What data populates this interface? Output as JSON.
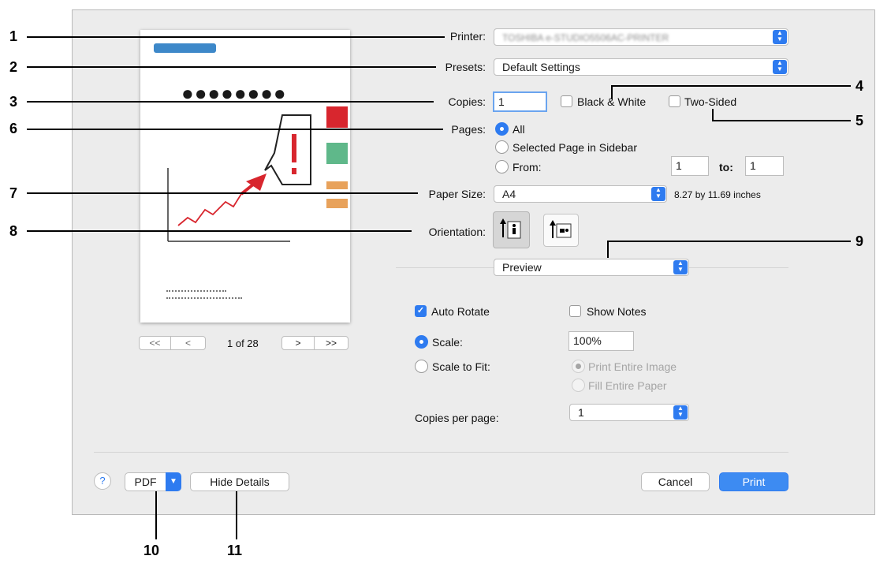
{
  "printer": {
    "label": "Printer:",
    "value": "TOSHIBA e-STUDIO5506AC-PRINTER"
  },
  "presets": {
    "label": "Presets:",
    "value": "Default Settings"
  },
  "copies": {
    "label": "Copies:",
    "value": "1",
    "bw_label": "Black & White",
    "two_sided_label": "Two-Sided"
  },
  "pages": {
    "label": "Pages:",
    "all": "All",
    "selected": "Selected Page in Sidebar",
    "from": "From:",
    "from_value": "1",
    "to_label": "to:",
    "to_value": "1"
  },
  "paper_size": {
    "label": "Paper Size:",
    "value": "A4",
    "dims": "8.27 by 11.69 inches"
  },
  "orientation": {
    "label": "Orientation:"
  },
  "section_popup": {
    "value": "Preview"
  },
  "preview_opts": {
    "auto_rotate": "Auto Rotate",
    "show_notes": "Show Notes",
    "scale": "Scale:",
    "scale_value": "100%",
    "scale_to_fit": "Scale to Fit:",
    "print_entire": "Print Entire Image",
    "fill_entire": "Fill Entire Paper",
    "copies_per_page": "Copies per page:",
    "copies_per_page_value": "1"
  },
  "nav": {
    "first": "<<",
    "prev": "<",
    "page": "1 of 28",
    "next": ">",
    "last": ">>"
  },
  "footer": {
    "help": "?",
    "pdf": "PDF",
    "hide_details": "Hide Details",
    "cancel": "Cancel",
    "print": "Print"
  },
  "callouts": [
    "1",
    "2",
    "3",
    "4",
    "5",
    "6",
    "7",
    "8",
    "9",
    "10",
    "11"
  ],
  "colors": {
    "accent": "#2e7bf0",
    "dialog_bg": "#ececec",
    "alert_red": "#d8262e"
  }
}
